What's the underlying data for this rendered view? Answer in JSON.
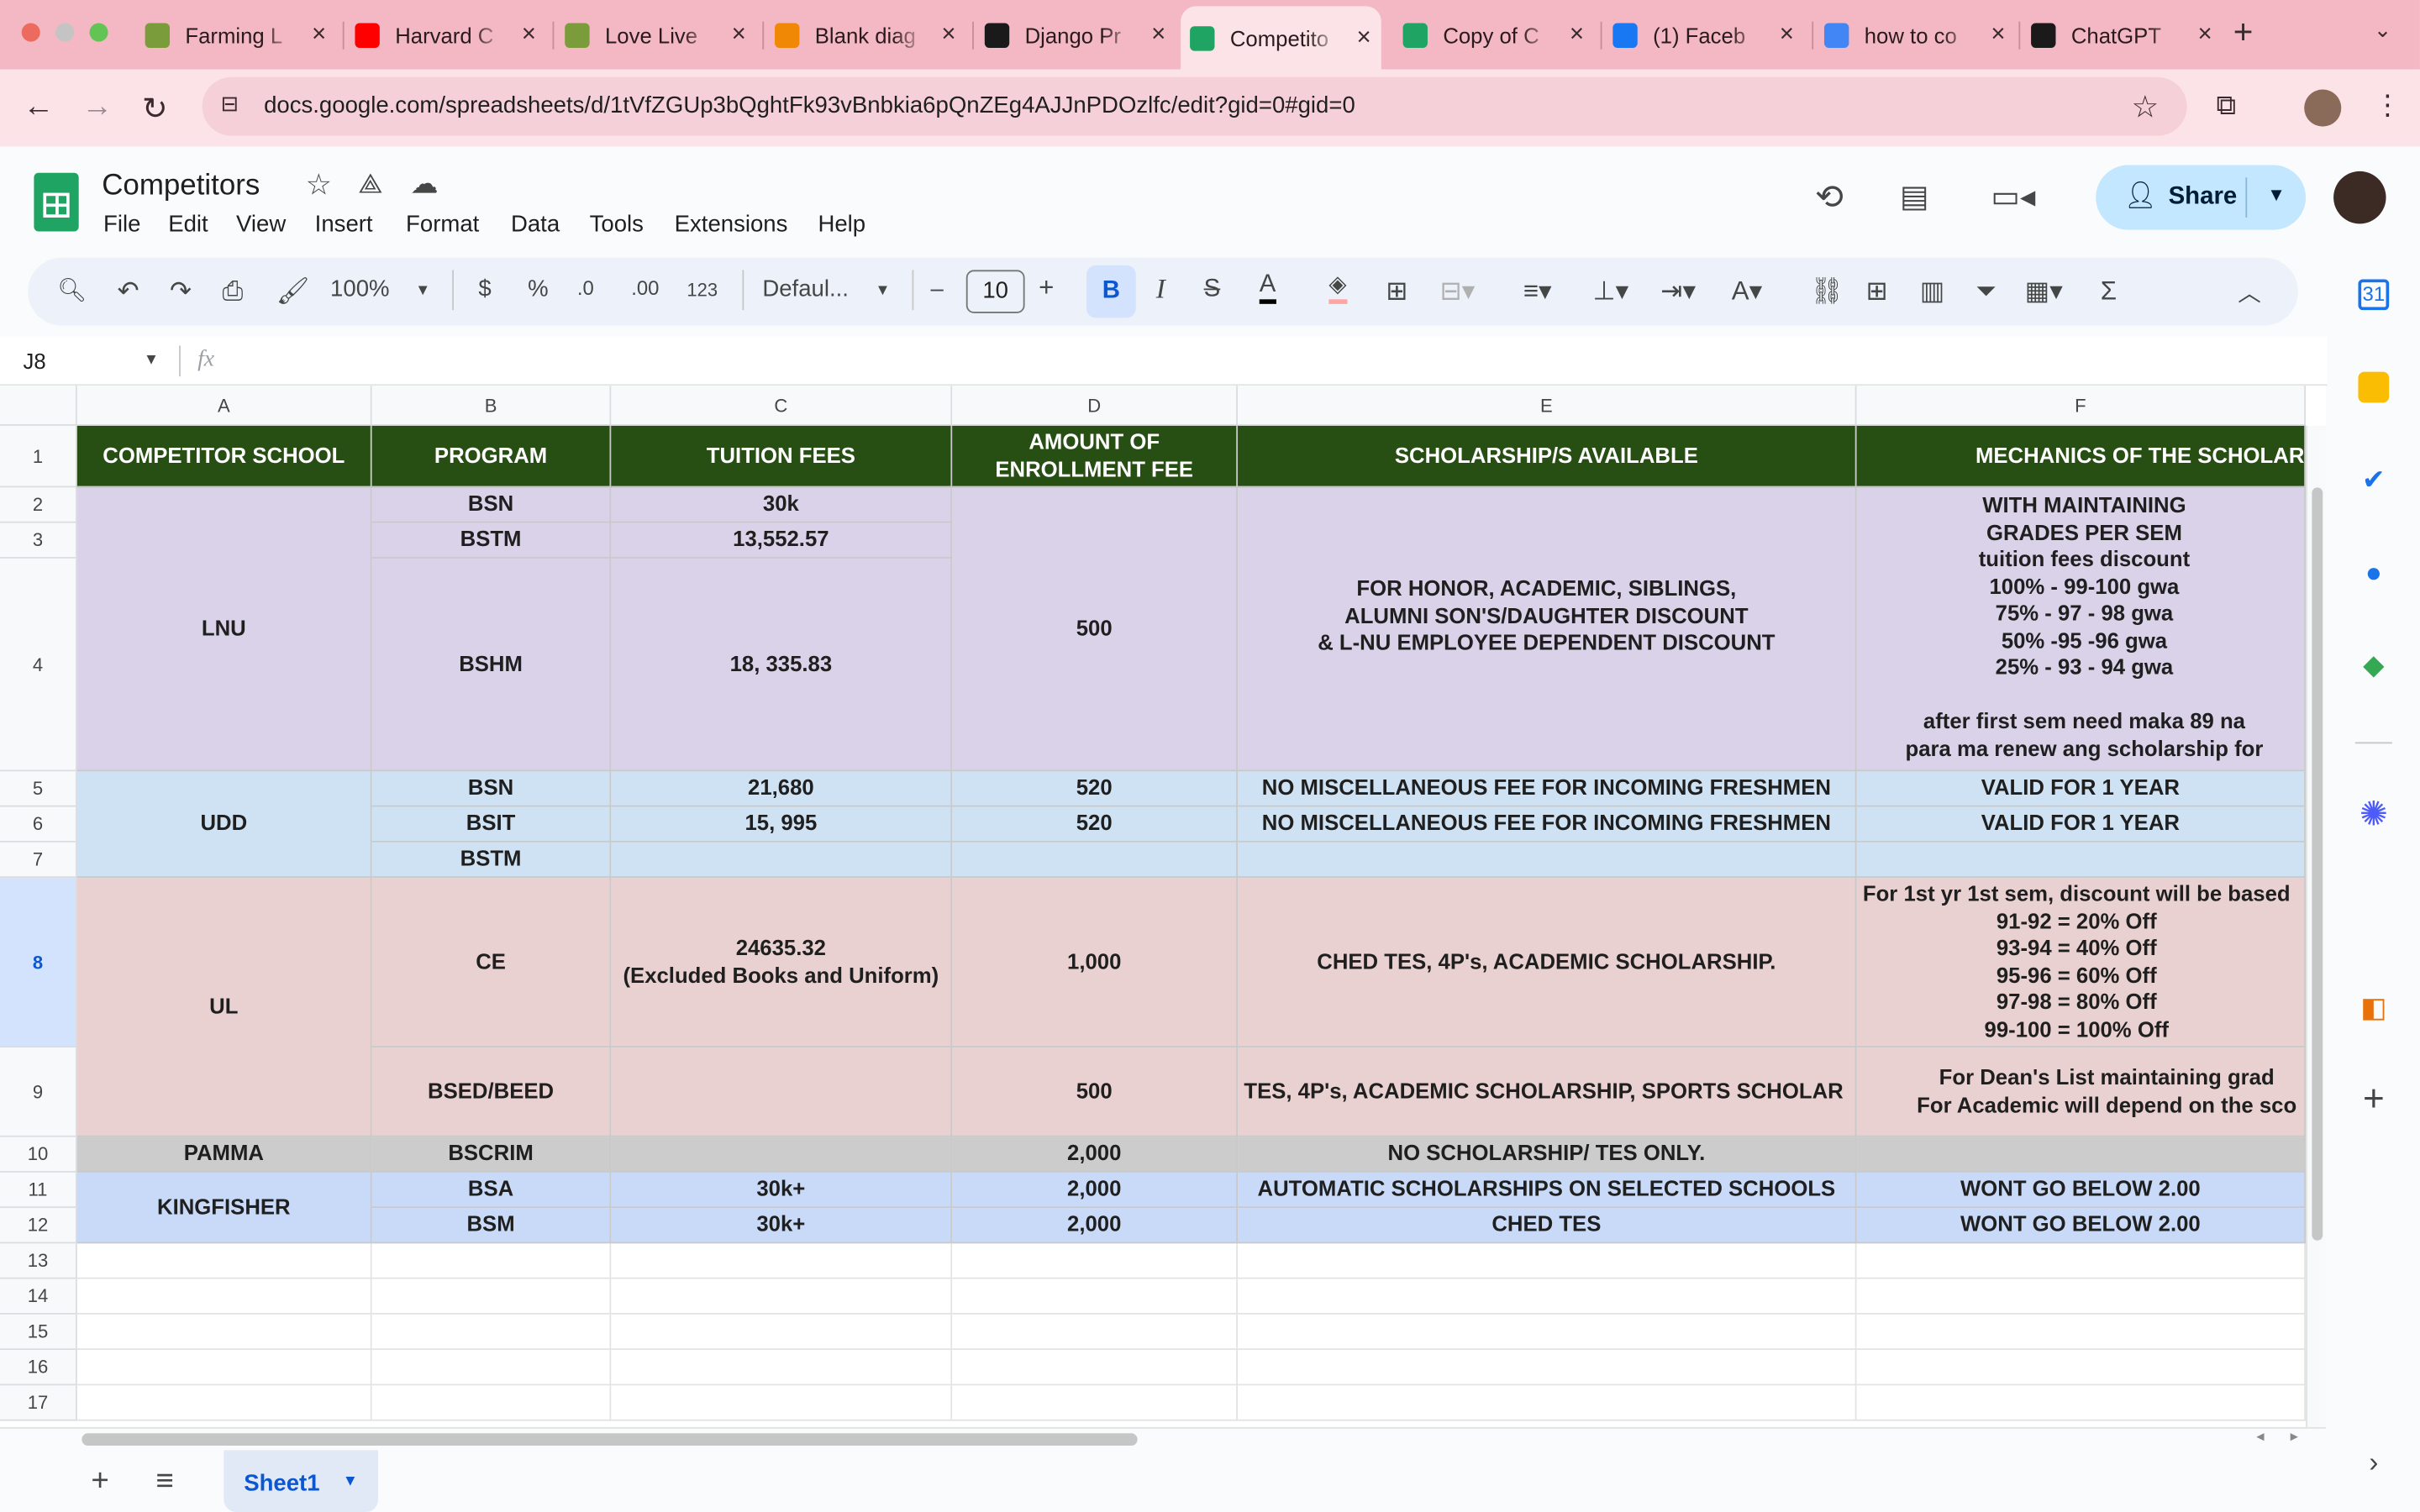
{
  "browser": {
    "tabs": [
      {
        "title": "Farming L",
        "icon": "farm-icon",
        "color": "#7b9c3a"
      },
      {
        "title": "Harvard C",
        "icon": "youtube-icon",
        "color": "#ff0000"
      },
      {
        "title": "Love Live",
        "icon": "farm-icon",
        "color": "#7b9c3a"
      },
      {
        "title": "Blank diag",
        "icon": "drawio-icon",
        "color": "#f08705"
      },
      {
        "title": "Django Pr",
        "icon": "chatgpt-icon",
        "color": "#1a1a1a"
      },
      {
        "title": "Competito",
        "icon": "sheets-icon",
        "color": "#1fa463"
      },
      {
        "title": "Copy of C",
        "icon": "sheets-icon",
        "color": "#1fa463"
      },
      {
        "title": "(1) Faceb",
        "icon": "facebook-icon",
        "color": "#1877f2"
      },
      {
        "title": "how to co",
        "icon": "google-icon",
        "color": "#4285f4"
      },
      {
        "title": "ChatGPT",
        "icon": "chatgpt-icon",
        "color": "#1a1a1a"
      }
    ],
    "active_tab": 5,
    "new_tab_symbol": "+",
    "url": "docs.google.com/spreadsheets/d/1tVfZGUp3bQghtFk93vBnbkia6pQnZEg4AJJnPDOzlfc/edit?gid=0#gid=0"
  },
  "app": {
    "title": "Competitors",
    "menu": [
      "File",
      "Edit",
      "View",
      "Insert",
      "Format",
      "Data",
      "Tools",
      "Extensions",
      "Help"
    ],
    "share_label": "Share"
  },
  "toolbar": {
    "zoom": "100%",
    "currency": "$",
    "percent": "%",
    "dec_decrease": ".0",
    "dec_increase": ".00",
    "number_format": "123",
    "font": "Defaul...",
    "font_size": "10",
    "bold": "B",
    "italic": "I",
    "text_color": "A",
    "minus": "–",
    "plus": "+"
  },
  "formula_bar": {
    "cell_ref": "J8",
    "fx": "fx",
    "value": ""
  },
  "columns": [
    "A",
    "B",
    "C",
    "D",
    "E",
    "F"
  ],
  "row_numbers": [
    "1",
    "2",
    "3",
    "4",
    "5",
    "6",
    "7",
    "8",
    "9",
    "10",
    "11",
    "12",
    "13",
    "14",
    "15",
    "16",
    "17"
  ],
  "colors": {
    "header_bg": "#274e13",
    "lnu": "#d9d2e9",
    "udd": "#cfe2f3",
    "ul": "#ead1d1",
    "pamma": "#cccccc",
    "kingfisher": "#c9daf8",
    "accent": "#0b57d0"
  },
  "sheet": {
    "headers": [
      "COMPETITOR SCHOOL",
      "PROGRAM",
      "TUITION FEES",
      "AMOUNT OF\nENROLLMENT FEE",
      "SCHOLARSHIP/S AVAILABLE",
      "MECHANICS OF THE SCHOLARSHIP"
    ],
    "lnu": {
      "school": "LNU",
      "programs": [
        "BSN",
        "BSTM",
        "BSHM"
      ],
      "tuition": [
        "30k",
        "13,552.57",
        "18, 335.83"
      ],
      "enrollment": "500",
      "scholarship": "FOR HONOR, ACADEMIC, SIBLINGS,\nALUMNI SON'S/DAUGHTER DISCOUNT\n& L-NU EMPLOYEE DEPENDENT DISCOUNT",
      "mechanics": "WITH MAINTAINING\nGRADES PER SEM\ntuition fees discount\n100% - 99-100 gwa\n75% - 97 - 98 gwa\n50% -95 -96 gwa\n25% - 93 - 94 gwa\n\nafter first sem need maka 89 na\npara ma renew ang scholarship for"
    },
    "udd": {
      "school": "UDD",
      "programs": [
        "BSN",
        "BSIT",
        "BSTM"
      ],
      "tuition": [
        "21,680",
        "15, 995",
        ""
      ],
      "enrollment": [
        "520",
        "520",
        ""
      ],
      "scholarship": [
        "NO MISCELLANEOUS FEE FOR INCOMING FRESHMEN",
        "NO MISCELLANEOUS FEE FOR INCOMING FRESHMEN",
        ""
      ],
      "mechanics": [
        "VALID FOR 1 YEAR",
        "VALID FOR 1 YEAR",
        ""
      ]
    },
    "ul": {
      "school": "UL",
      "programs": [
        "CE",
        "BSED/BEED"
      ],
      "tuition": [
        "24635.32\n(Excluded Books and Uniform)",
        ""
      ],
      "enrollment": [
        "1,000",
        "500"
      ],
      "scholarship": [
        "CHED TES, 4P's, ACADEMIC SCHOLARSHIP.",
        "TES, 4P's, ACADEMIC SCHOLARSHIP, SPORTS SCHOLAR"
      ],
      "mechanics": [
        "For 1st yr 1st sem, discount will be based\n91-92 = 20% Off\n93-94 = 40% Off\n95-96 = 60% Off\n97-98 = 80% Off\n99-100 = 100% Off",
        "For Dean's List maintaining grad\nFor Academic will depend on the sco"
      ]
    },
    "pamma": {
      "school": "PAMMA",
      "program": "BSCRIM",
      "tuition": "",
      "enrollment": "2,000",
      "scholarship": "NO SCHOLARSHIP/ TES ONLY.",
      "mechanics": ""
    },
    "kingfisher": {
      "school": "KINGFISHER",
      "programs": [
        "BSA",
        "BSM"
      ],
      "tuition": [
        "30k+",
        "30k+"
      ],
      "enrollment": [
        "2,000",
        "2,000"
      ],
      "scholarship": [
        "AUTOMATIC SCHOLARSHIPS ON SELECTED SCHOOLS",
        "CHED TES"
      ],
      "mechanics": [
        "WONT GO BELOW 2.00",
        "WONT GO BELOW 2.00"
      ]
    }
  },
  "sheet_tab": {
    "name": "Sheet1",
    "add": "+",
    "list": "≡"
  }
}
